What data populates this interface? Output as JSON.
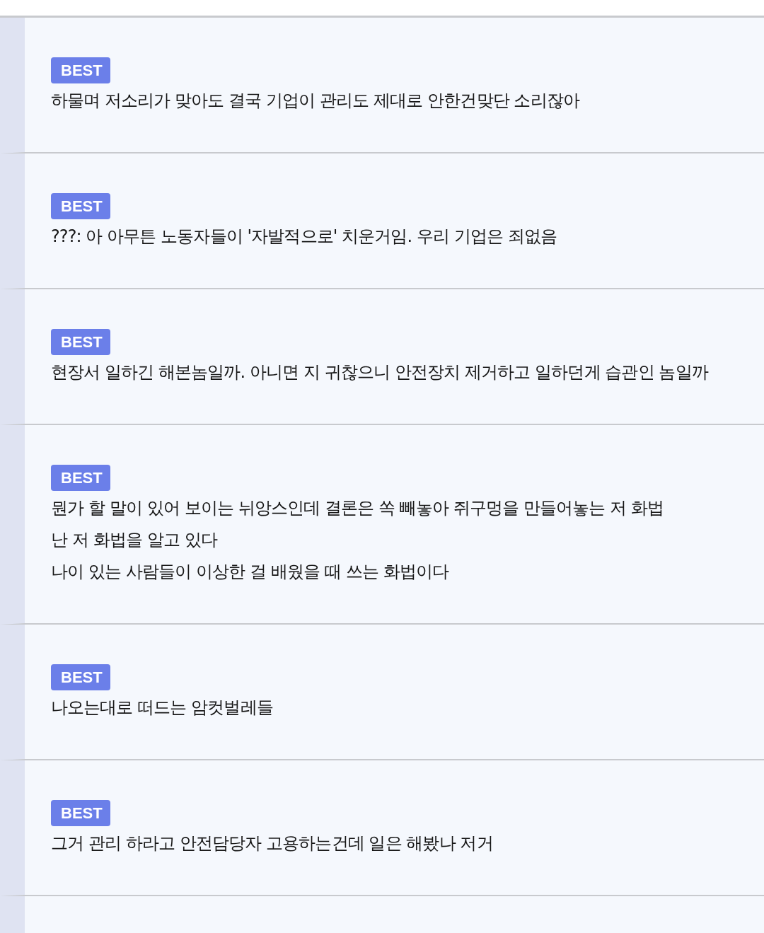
{
  "comments": [
    {
      "badge": "BEST",
      "text": "하물며 저소리가 맞아도 결국 기업이 관리도 제대로 안한건맞단 소리잖아"
    },
    {
      "badge": "BEST",
      "text": "???: 아 아무튼 노동자들이 '자발적으로' 치운거임. 우리 기업은 죄없음"
    },
    {
      "badge": "BEST",
      "text": "현장서 일하긴 해본놈일까. 아니면 지 귀찮으니 안전장치 제거하고 일하던게 습관인 놈일까"
    },
    {
      "badge": "BEST",
      "text": "뭔가 할 말이 있어 보이는 뉘앙스인데 결론은 쏙 빼놓아 쥐구멍을 만들어놓는 저 화법\n난 저 화법을 알고 있다\n나이 있는 사람들이 이상한 걸 배웠을 때 쓰는 화법이다"
    },
    {
      "badge": "BEST",
      "text": "나오는대로 떠드는 암컷벌레들"
    },
    {
      "badge": "BEST",
      "text": "그거 관리 하라고 안전담당자 고용하는건데 일은 해봤나 저거"
    }
  ]
}
